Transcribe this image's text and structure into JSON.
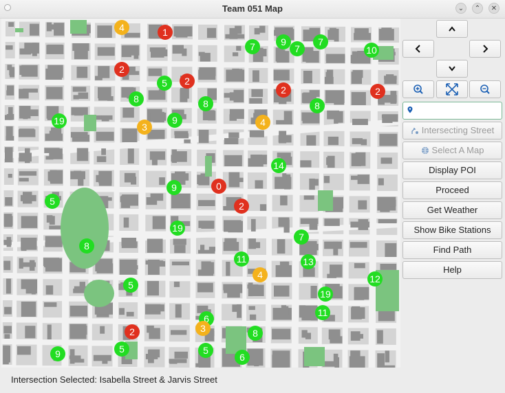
{
  "window": {
    "title": "Team 051 Map"
  },
  "titlebar_buttons": [
    {
      "name": "minimize-button",
      "glyph": "⌄"
    },
    {
      "name": "maximize-button",
      "glyph": "⌃"
    },
    {
      "name": "close-button",
      "glyph": "✕"
    }
  ],
  "markers": [
    {
      "label": "4",
      "color": "orange"
    },
    {
      "label": "1",
      "color": "red"
    },
    {
      "label": "7",
      "color": "green"
    },
    {
      "label": "9",
      "color": "green"
    },
    {
      "label": "7",
      "color": "green"
    },
    {
      "label": "7",
      "color": "green"
    },
    {
      "label": "10",
      "color": "green"
    },
    {
      "label": "2",
      "color": "red"
    },
    {
      "label": "5",
      "color": "green"
    },
    {
      "label": "2",
      "color": "red"
    },
    {
      "label": "2",
      "color": "red"
    },
    {
      "label": "2",
      "color": "red"
    },
    {
      "label": "8",
      "color": "green"
    },
    {
      "label": "8",
      "color": "green"
    },
    {
      "label": "8",
      "color": "green"
    },
    {
      "label": "19",
      "color": "green"
    },
    {
      "label": "3",
      "color": "orange"
    },
    {
      "label": "9",
      "color": "green"
    },
    {
      "label": "4",
      "color": "orange"
    },
    {
      "label": "14",
      "color": "green"
    },
    {
      "label": "5",
      "color": "green"
    },
    {
      "label": "9",
      "color": "green"
    },
    {
      "label": "0",
      "color": "red"
    },
    {
      "label": "2",
      "color": "red"
    },
    {
      "label": "19",
      "color": "green"
    },
    {
      "label": "8",
      "color": "green"
    },
    {
      "label": "7",
      "color": "green"
    },
    {
      "label": "11",
      "color": "green"
    },
    {
      "label": "13",
      "color": "green"
    },
    {
      "label": "4",
      "color": "orange"
    },
    {
      "label": "12",
      "color": "green"
    },
    {
      "label": "5",
      "color": "green"
    },
    {
      "label": "19",
      "color": "green"
    },
    {
      "label": "11",
      "color": "green"
    },
    {
      "label": "6",
      "color": "green"
    },
    {
      "label": "3",
      "color": "orange"
    },
    {
      "label": "2",
      "color": "red"
    },
    {
      "label": "8",
      "color": "green"
    },
    {
      "label": "9",
      "color": "green"
    },
    {
      "label": "5",
      "color": "green"
    },
    {
      "label": "5",
      "color": "green"
    },
    {
      "label": "6",
      "color": "green"
    }
  ],
  "marker_colors": {
    "green": "#22dd22",
    "red": "#e0301e",
    "orange": "#f4b21c"
  },
  "map_colors": {
    "road": "#f2f2f2",
    "block": "#d4d4d4",
    "building": "#8f8f8f",
    "park": "#7bc47f"
  },
  "nav": {
    "up_icon": "chevron-up",
    "left_icon": "chevron-left",
    "right_icon": "chevron-right",
    "down_icon": "chevron-down",
    "zoom_in_icon": "zoom-in",
    "zoom_fit_icon": "zoom-fit",
    "zoom_out_icon": "zoom-out"
  },
  "search": {
    "value": "",
    "icon": "location-pin"
  },
  "buttons": {
    "intersecting_street": "Intersecting Street",
    "select_map": "Select A Map",
    "display_poi": "Display POI",
    "proceed": "Proceed",
    "get_weather": "Get Weather",
    "show_bike_stations": "Show Bike Stations",
    "find_path": "Find Path",
    "help": "Help"
  },
  "status": "Intersection Selected: Isabella Street & Jarvis Street"
}
